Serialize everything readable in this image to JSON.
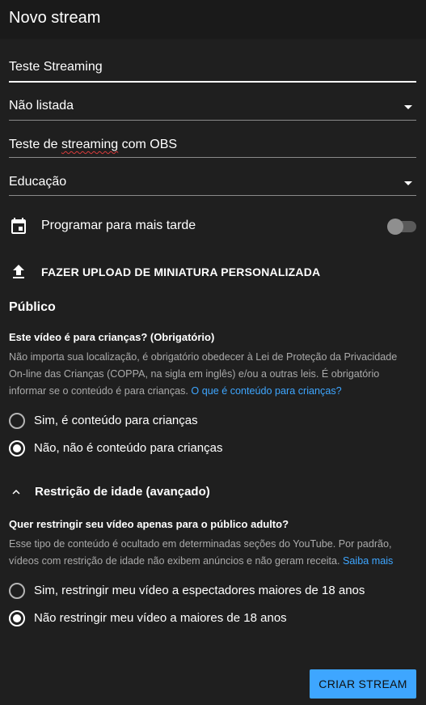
{
  "header": {
    "title": "Novo stream"
  },
  "form": {
    "title_value": "Teste Streaming",
    "visibility_value": "Não listada",
    "description_value_part1": "Teste de ",
    "description_value_misspelled": "streaming",
    "description_value_part2": " com OBS",
    "category_value": "Educação",
    "schedule_label": "Programar para mais tarde",
    "schedule_enabled": false,
    "upload_label": "FAZER UPLOAD DE MINIATURA PERSONALIZADA"
  },
  "audience": {
    "section_title": "Público",
    "question": "Este vídeo é para crianças? (Obrigatório)",
    "info_text": "Não importa sua localização, é obrigatório obedecer à Lei de Proteção da Privacidade On-line das Crianças (COPPA, na sigla em inglês) e/ou a outras leis. É obrigatório informar se o conteúdo é para crianças. ",
    "info_link": "O que é conteúdo para crianças?",
    "options": [
      {
        "label": "Sim, é conteúdo para crianças",
        "checked": false
      },
      {
        "label": "Não, não é conteúdo para crianças",
        "checked": true
      }
    ]
  },
  "age_restriction": {
    "title": "Restrição de idade (avançado)",
    "question": "Quer restringir seu vídeo apenas para o público adulto?",
    "info_text": "Esse tipo de conteúdo é ocultado em determinadas seções do YouTube. Por padrão, vídeos com restrição de idade não exibem anúncios e não geram receita. ",
    "info_link": "Saiba mais",
    "options": [
      {
        "label": "Sim, restringir meu vídeo a espectadores maiores de 18 anos",
        "checked": false
      },
      {
        "label": "Não restringir meu vídeo a maiores de 18 anos",
        "checked": true
      }
    ]
  },
  "actions": {
    "create_label": "CRIAR STREAM"
  },
  "colors": {
    "background": "#1f1f1f",
    "header_background": "#1a1a1a",
    "accent": "#3ea6ff",
    "muted_text": "#aaaaaa"
  },
  "icons": {
    "calendar": "calendar-icon",
    "upload": "upload-icon",
    "chevron": "chevron-up-icon"
  }
}
